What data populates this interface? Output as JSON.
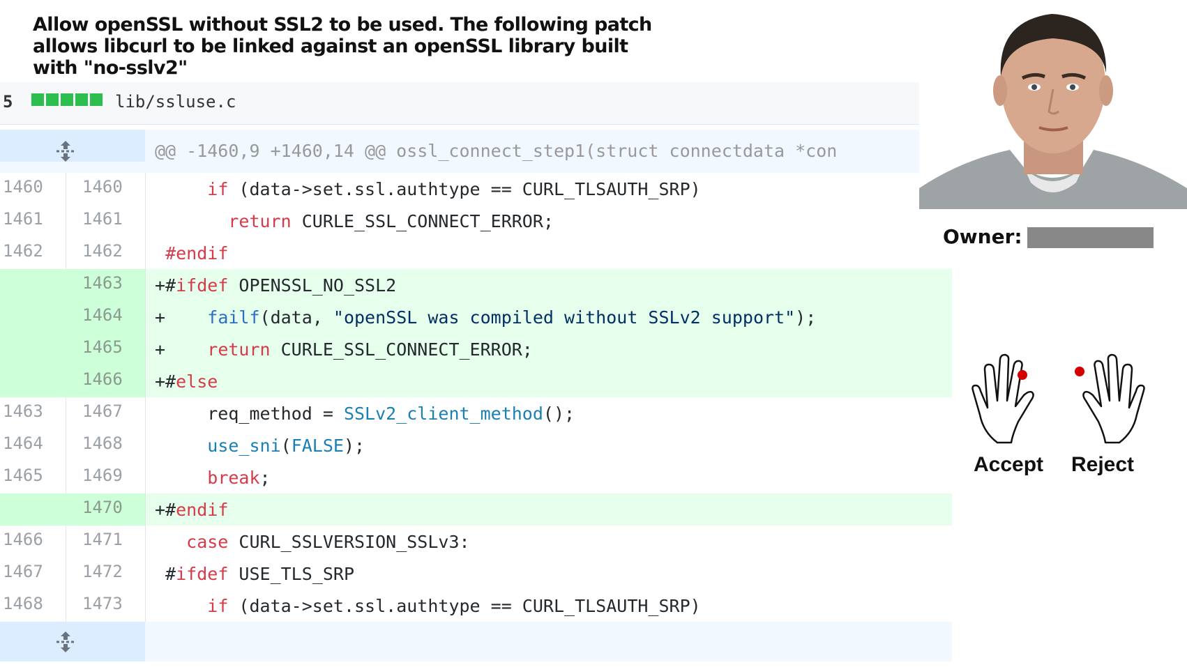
{
  "commit_message": "Allow openSSL without SSL2 to be used.  The following patch\nallows libcurl to be linked against an openSSL library built\nwith \"no-sslv2\"",
  "file": {
    "changes": "5",
    "name": "lib/ssluse.c"
  },
  "hunk_header": "@@ -1460,9 +1460,14 @@ ossl_connect_step1(struct connectdata *con",
  "lines": [
    {
      "old": "1460",
      "new": "1460",
      "type": "ctx"
    },
    {
      "old": "1461",
      "new": "1461",
      "type": "ctx"
    },
    {
      "old": "1462",
      "new": "1462",
      "type": "ctx"
    },
    {
      "old": "",
      "new": "1463",
      "type": "add"
    },
    {
      "old": "",
      "new": "1464",
      "type": "add"
    },
    {
      "old": "",
      "new": "1465",
      "type": "add"
    },
    {
      "old": "",
      "new": "1466",
      "type": "add"
    },
    {
      "old": "1463",
      "new": "1467",
      "type": "ctx"
    },
    {
      "old": "1464",
      "new": "1468",
      "type": "ctx"
    },
    {
      "old": "1465",
      "new": "1469",
      "type": "ctx"
    },
    {
      "old": "",
      "new": "1470",
      "type": "add"
    },
    {
      "old": "1466",
      "new": "1471",
      "type": "ctx"
    },
    {
      "old": "1467",
      "new": "1472",
      "type": "ctx"
    },
    {
      "old": "1468",
      "new": "1473",
      "type": "ctx"
    }
  ],
  "code_tokens": {
    "l0": [
      "     ",
      "if",
      " (data->set.ssl.authtype == CURL_TLSAUTH_SRP)"
    ],
    "l1": [
      "       ",
      "return",
      " CURLE_SSL_CONNECT_ERROR;"
    ],
    "l2": [
      " ",
      "#endif"
    ],
    "l3": [
      "+#",
      "ifdef",
      " OPENSSL_NO_SSL2"
    ],
    "l4": [
      "+    ",
      "failf",
      "(data, ",
      "\"openSSL was compiled without SSLv2 support\"",
      ");"
    ],
    "l5": [
      "+    ",
      "return",
      " CURLE_SSL_CONNECT_ERROR;"
    ],
    "l6": [
      "+#",
      "else"
    ],
    "l7": [
      "     req_method = ",
      "SSLv2_client_method",
      "();"
    ],
    "l8": [
      "     ",
      "use_sni",
      "(",
      "FALSE",
      ");"
    ],
    "l9": [
      "     ",
      "break",
      ";"
    ],
    "l10": [
      "+#",
      "endif"
    ],
    "l11": [
      "   ",
      "case",
      " CURL_SSLVERSION_SSLv3:"
    ],
    "l12": [
      " #",
      "ifdef",
      " USE_TLS_SRP"
    ],
    "l13": [
      "     ",
      "if",
      " (data->set.ssl.authtype == CURL_TLSAUTH_SRP)"
    ]
  },
  "owner": {
    "label": "Owner:"
  },
  "actions": {
    "accept": "Accept",
    "reject": "Reject"
  },
  "icons": {
    "expand": "unfold-icon",
    "hand_left": "left-hand-icon",
    "hand_right": "right-hand-icon"
  },
  "colors": {
    "add_bg": "#e6ffed",
    "add_gutter": "#cdffd8",
    "hunk_bg": "#f1f8ff",
    "keyword": "#d73a49",
    "string": "#032f62",
    "function": "#005cc5"
  }
}
